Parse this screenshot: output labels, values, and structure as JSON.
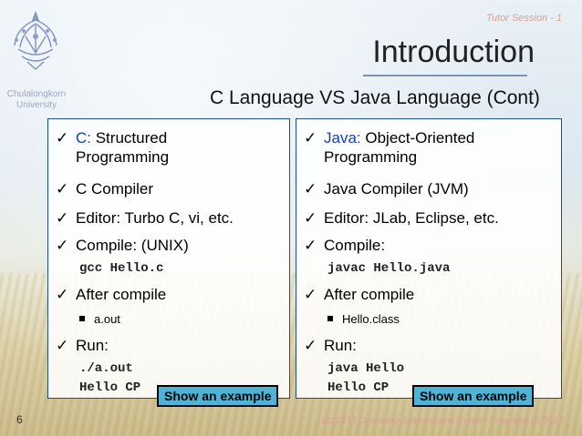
{
  "header": {
    "session": "Tutor Session - 1",
    "title": "Introduction",
    "subtitle": "C Language VS Java Language (Cont)"
  },
  "logo": {
    "line1": "Chulalongkorn",
    "line2": "University"
  },
  "left": {
    "items": [
      {
        "prefix": "C:",
        "text": " Structured",
        "text2": "Programming"
      },
      {
        "text": "C Compiler"
      },
      {
        "text": "Editor: Turbo C, vi, etc."
      },
      {
        "text": "Compile: (UNIX)"
      },
      {
        "text": "After compile"
      },
      {
        "text": "Run:"
      }
    ],
    "compile_cmd": "gcc Hello.c",
    "output_file": "a.out",
    "run_cmd": "./a.out",
    "run_output": "Hello CP",
    "example_button": "Show an example"
  },
  "right": {
    "items": [
      {
        "prefix": "Java:",
        "text": " Object-Oriented",
        "text2": "Programming"
      },
      {
        "text": "Java Compiler (JVM)"
      },
      {
        "text": "Editor: JLab, Eclipse, etc."
      },
      {
        "text": "Compile:"
      },
      {
        "text": "After compile"
      },
      {
        "text": "Run:"
      }
    ],
    "compile_cmd": "javac Hello.java",
    "output_file": "Hello.class",
    "run_cmd": "java Hello",
    "run_output": "Hello CP",
    "example_button": "Show an example"
  },
  "footer": {
    "page_number": "6",
    "course": "2110313 Operating Systems and System Programs (1/2010)"
  },
  "icons": {
    "bullet": "check-icon",
    "sub_bullet": "square-bullet-icon",
    "logo": "university-seal-icon"
  },
  "colors": {
    "accent_text": "#1a3fb0",
    "button_bg": "#4fb3d6",
    "box_border": "#1f4f7f"
  }
}
